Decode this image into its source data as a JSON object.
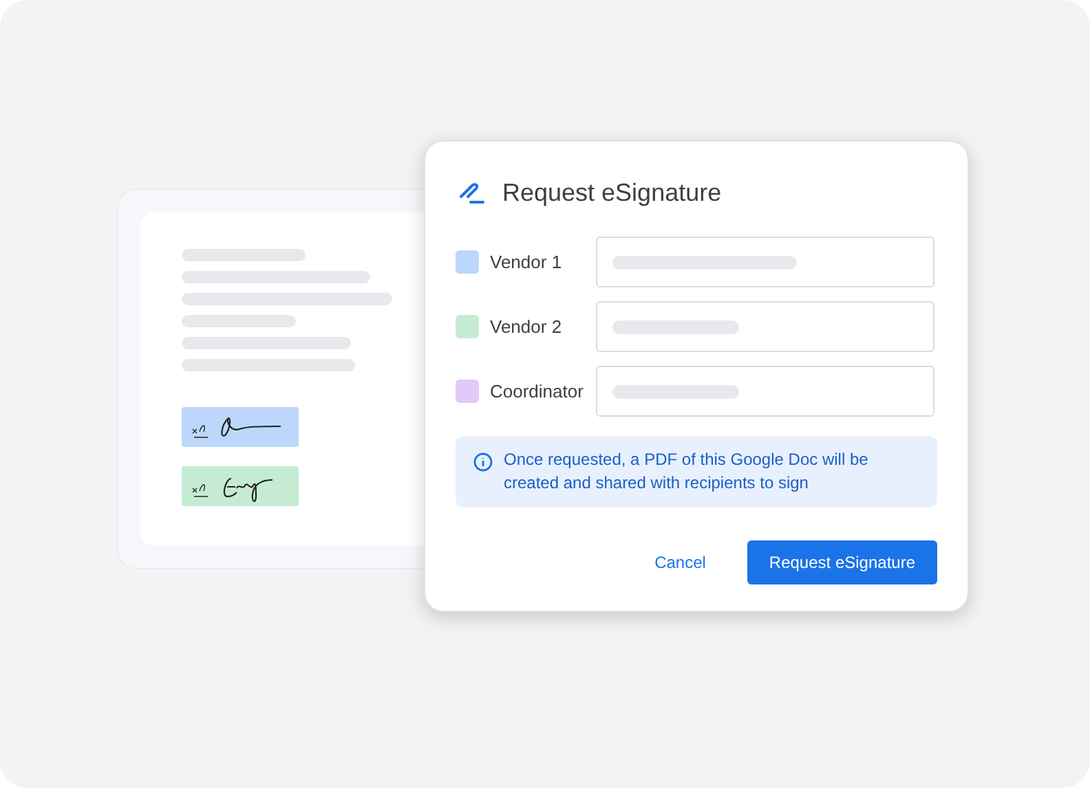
{
  "document": {
    "signatures": [
      {
        "color": "#bcd7fb"
      },
      {
        "color": "#c5ecd2"
      }
    ]
  },
  "dialog": {
    "title": "Request eSignature",
    "signers": [
      {
        "label": "Vendor 1",
        "color": "#bcd7fb"
      },
      {
        "label": "Vendor 2",
        "color": "#c5ecd2"
      },
      {
        "label": "Coordinator",
        "color": "#e2c9f7"
      }
    ],
    "info": "Once requested, a PDF of this Google Doc will be created and shared with recipients to sign",
    "buttons": [
      {
        "label": "Cancel",
        "kind": "text"
      },
      {
        "label": "Request eSignature",
        "kind": "primary"
      }
    ]
  }
}
